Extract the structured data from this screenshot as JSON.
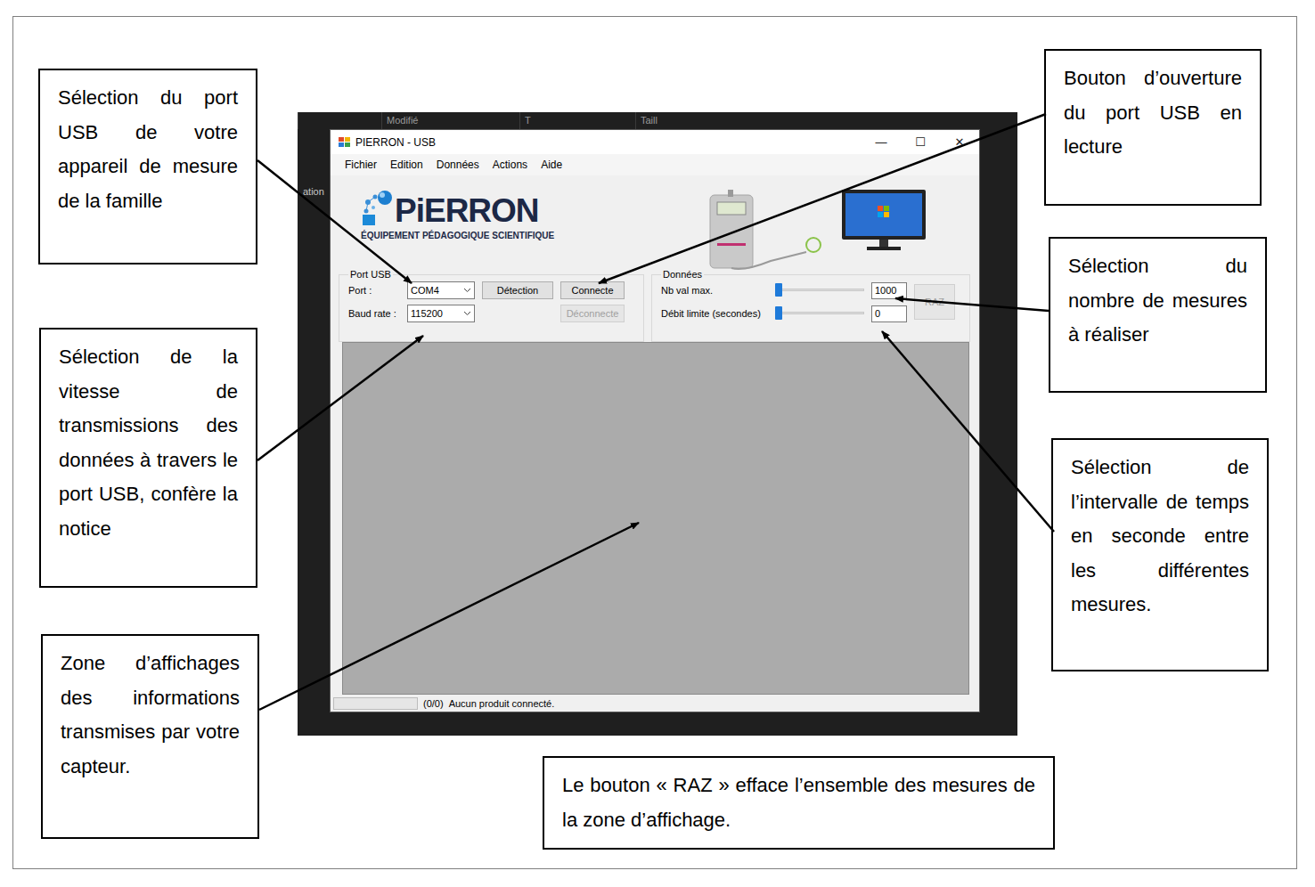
{
  "screenshot": {
    "background_texts": [
      "Modifié",
      "T",
      "Taill",
      "ation"
    ],
    "window": {
      "title": "PIERRON - USB",
      "controls": [
        "—",
        "☐",
        "✕"
      ],
      "menu": [
        "Fichier",
        "Edition",
        "Données",
        "Actions",
        "Aide"
      ],
      "logo": {
        "brand": "PiERRON",
        "tagline": "ÉQUIPEMENT PÉDAGOGIQUE SCIENTIFIQUE"
      },
      "port_group": {
        "title": "Port USB",
        "port_label": "Port :",
        "port_value": "COM4",
        "detect_button": "Détection",
        "baud_label": "Baud rate :",
        "baud_value": "115200",
        "buttons": [
          {
            "label": "Connecte",
            "disabled": false
          },
          {
            "label": "Déconnecte",
            "disabled": true
          }
        ]
      },
      "data_group": {
        "title": "Données",
        "rows": [
          {
            "label": "Nb val max.",
            "level": 0,
            "value": "1000"
          },
          {
            "label": "Débit limite (secondes)",
            "level": 0,
            "value": "0"
          }
        ],
        "raz": {
          "label": "RAZ",
          "disabled": true
        }
      },
      "status_bar": {
        "progress": 0,
        "count": "(0/0)",
        "message": "Aucun produit connecté."
      }
    }
  },
  "callouts": [
    {
      "text": "Sélection du port USB de votre appareil de mesure de la famille"
    },
    {
      "text": "Sélection de la vitesse de transmissions des données à travers le port USB, confère la notice"
    },
    {
      "text": "Zone d’affichages des informations transmises par votre capteur."
    },
    {
      "text": "Bouton d’ouverture du port USB en lecture"
    },
    {
      "text": "Sélection du nombre de mesures à réaliser"
    },
    {
      "text": "Sélection de l’intervalle de temps en seconde entre les différentes mesures."
    },
    {
      "text": "Le bouton « RAZ » efface l’ensemble des mesures de la zone d’affichage."
    }
  ]
}
